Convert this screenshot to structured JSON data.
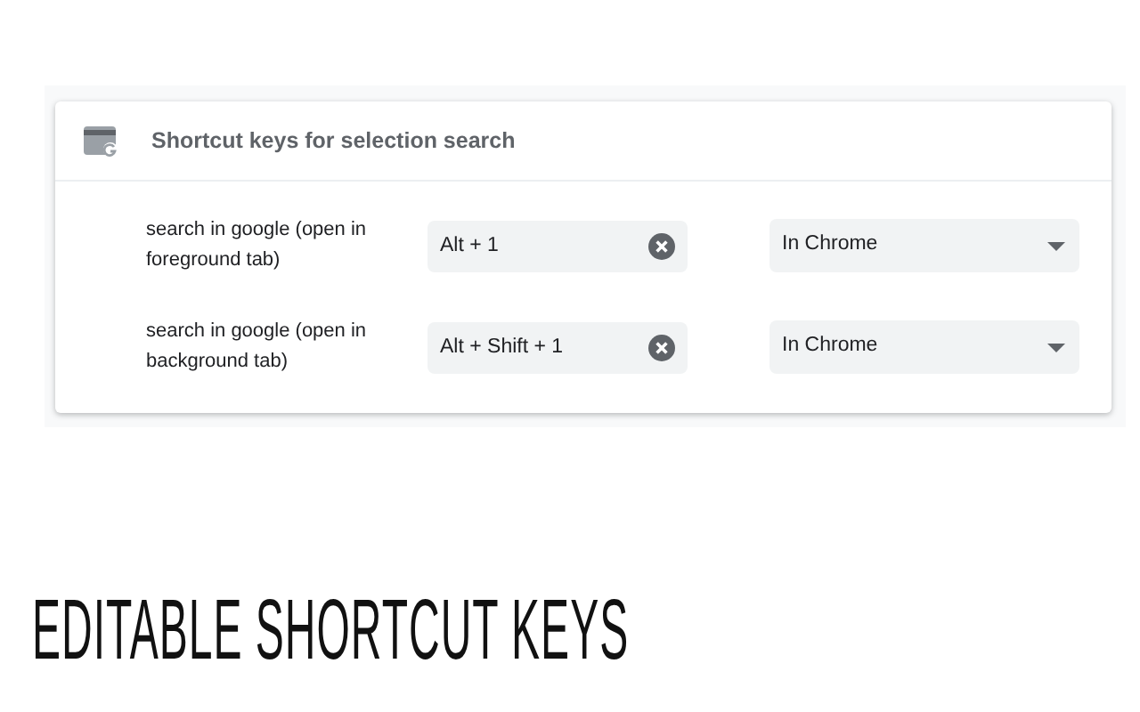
{
  "card": {
    "title": "Shortcut keys for selection search",
    "shortcuts": [
      {
        "label": "search in google (open in foreground tab)",
        "keys": "Alt + 1",
        "scope": "In Chrome"
      },
      {
        "label": "search in google (open in background tab)",
        "keys": "Alt + Shift + 1",
        "scope": "In Chrome"
      }
    ]
  },
  "caption": "EDITABLE SHORTCUT KEYS"
}
